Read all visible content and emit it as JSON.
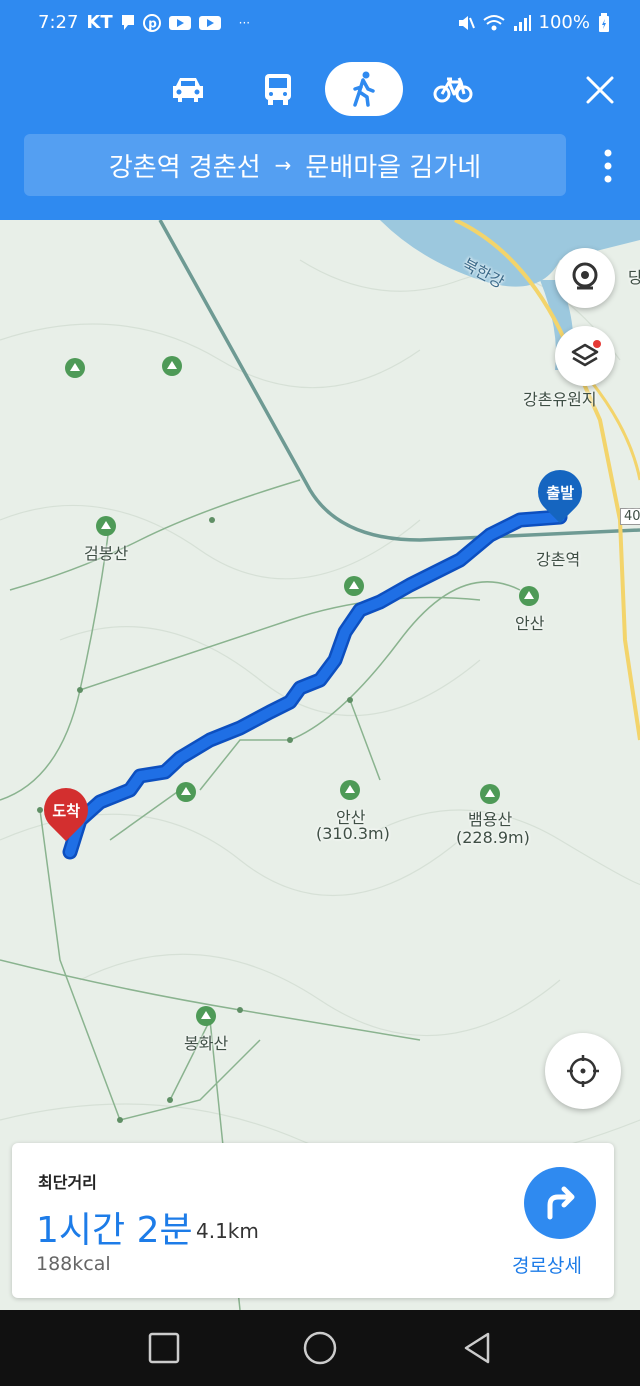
{
  "status": {
    "time": "7:27",
    "carrier": "KT",
    "more": "···",
    "battery": "100%"
  },
  "modes": [
    {
      "name": "car",
      "icon": "car-icon",
      "active": false
    },
    {
      "name": "bus",
      "icon": "bus-icon",
      "active": false
    },
    {
      "name": "walk",
      "icon": "walk-icon",
      "active": true
    },
    {
      "name": "bike",
      "icon": "bike-icon",
      "active": false
    }
  ],
  "route": {
    "from": "강촌역 경춘선",
    "arrow": "→",
    "to": "문배마을 김가네"
  },
  "map": {
    "labels": {
      "river": "북한강",
      "resort": "강촌유원지",
      "station": "강촌역",
      "geombong": "검봉산",
      "ansan1": "안산",
      "ansan2": "안산",
      "ansan2_height": "(310.3m)",
      "baemyong": "뱀용산",
      "baemyong_height": "(228.9m)",
      "bonghwa": "봉화산",
      "road_number": "40",
      "edge_letter": "당"
    },
    "start_pin": "출발",
    "end_pin": "도착",
    "route_color": "#1f6fe5",
    "accent_start": "#1565c0",
    "accent_end": "#d32f2f"
  },
  "summary": {
    "title": "최단거리",
    "time": "1시간 2분",
    "distance": "4.1km",
    "calories": "188kcal",
    "detail_label": "경로상세"
  },
  "colors": {
    "header": "#2f8af0",
    "accent": "#1d7ce8"
  }
}
